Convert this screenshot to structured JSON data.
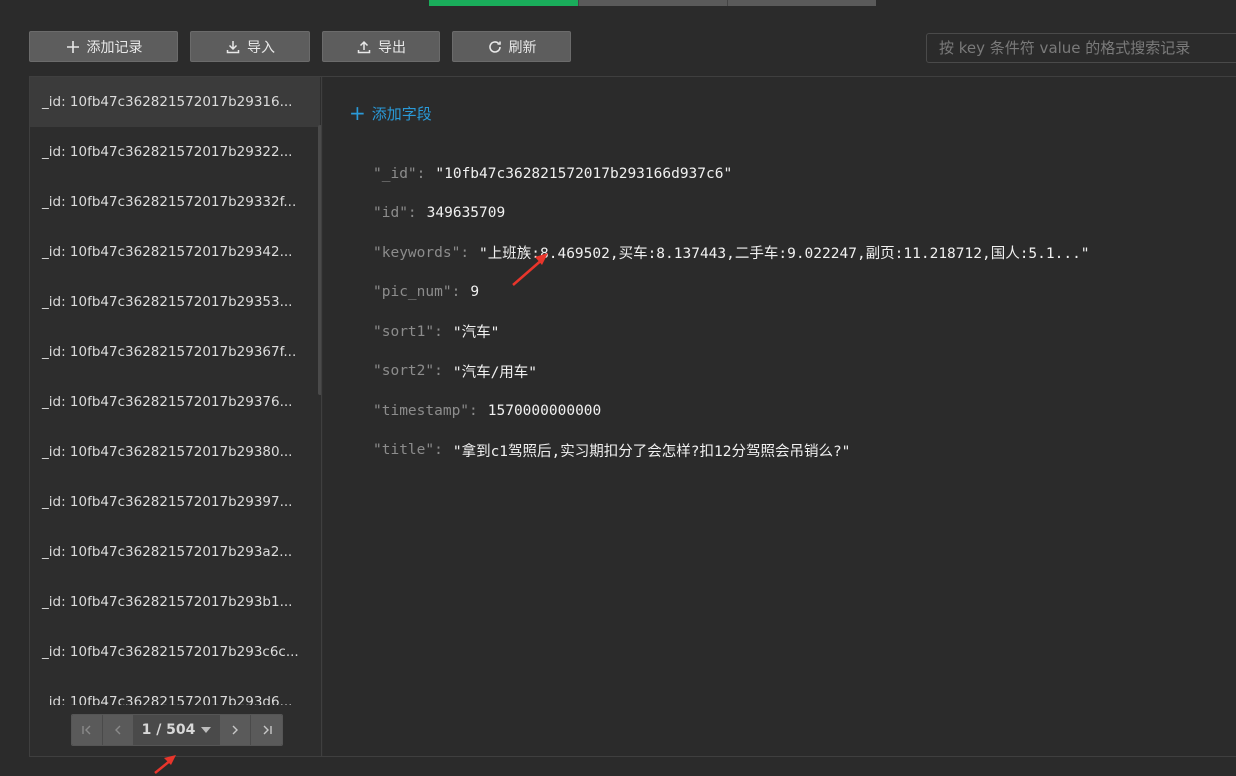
{
  "toolbar": {
    "add_label": "添加记录",
    "import_label": "导入",
    "export_label": "导出",
    "refresh_label": "刷新"
  },
  "search": {
    "placeholder": "按 key 条件符 value 的格式搜索记录"
  },
  "list": {
    "items": [
      "_id: 10fb47c362821572017b29316...",
      "_id: 10fb47c362821572017b29322...",
      "_id: 10fb47c362821572017b29332f...",
      "_id: 10fb47c362821572017b29342...",
      "_id: 10fb47c362821572017b29353...",
      "_id: 10fb47c362821572017b29367f...",
      "_id: 10fb47c362821572017b29376...",
      "_id: 10fb47c362821572017b29380...",
      "_id: 10fb47c362821572017b29397...",
      "_id: 10fb47c362821572017b293a2...",
      "_id: 10fb47c362821572017b293b1...",
      "_id: 10fb47c362821572017b293c6c...",
      "_id: 10fb47c362821572017b293d6..."
    ]
  },
  "pager": {
    "page_label": "1 / 504"
  },
  "detail": {
    "add_field_label": "添加字段",
    "fields": [
      {
        "key": "\"_id\"",
        "value": "\"10fb47c362821572017b293166d937c6\""
      },
      {
        "key": "\"id\"",
        "value": "349635709"
      },
      {
        "key": "\"keywords\"",
        "value": "\"上班族:8.469502,买车:8.137443,二手车:9.022247,副页:11.218712,国人:5.1...\""
      },
      {
        "key": "\"pic_num\"",
        "value": "9"
      },
      {
        "key": "\"sort1\"",
        "value": "\"汽车\""
      },
      {
        "key": "\"sort2\"",
        "value": "\"汽车/用车\""
      },
      {
        "key": "\"timestamp\"",
        "value": "1570000000000"
      },
      {
        "key": "\"title\"",
        "value": "\"拿到c1驾照后,实习期扣分了会怎样?扣12分驾照会吊销么?\""
      }
    ]
  },
  "colors": {
    "accent_green": "#1aad5b",
    "link_blue": "#2a9ad8",
    "annotation_red": "#e8352b"
  }
}
